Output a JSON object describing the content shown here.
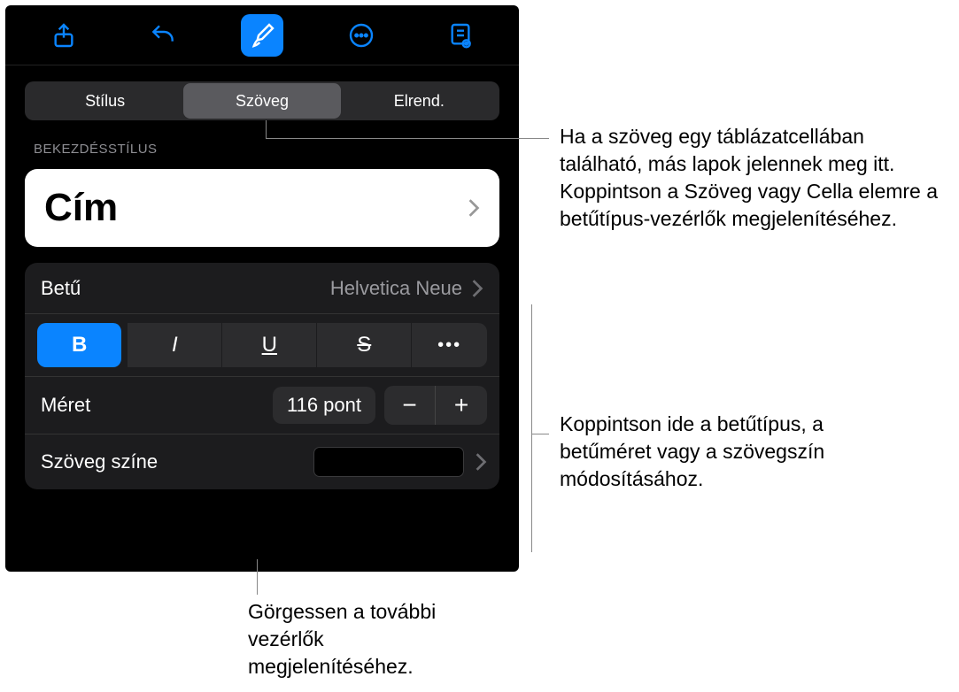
{
  "toolbar_icons": [
    "share",
    "undo",
    "brush",
    "more",
    "read"
  ],
  "tabs": {
    "style": "Stílus",
    "text": "Szöveg",
    "arrange": "Elrend."
  },
  "section_label": "BEKEZDÉSSTÍLUS",
  "paragraph_style": "Cím",
  "font": {
    "label": "Betű",
    "value": "Helvetica Neue"
  },
  "styles": {
    "bold": "B",
    "italic": "I",
    "underline": "U",
    "strike": "S",
    "more": "•••"
  },
  "size": {
    "label": "Méret",
    "value": "116 pont",
    "minus": "−",
    "plus": "+"
  },
  "text_color": {
    "label": "Szöveg színe",
    "value": "#000000"
  },
  "callouts": {
    "top": "Ha a szöveg egy táblázatcellában található, más lapok jelennek meg itt. Koppintson a Szöveg vagy Cella elemre a betűtípus-vezérlők megjelenítéséhez.",
    "middle": "Koppintson ide a betűtípus, a betűméret vagy a szövegszín módosításához.",
    "bottom": "Görgessen a további vezérlők megjelenítéséhez."
  }
}
